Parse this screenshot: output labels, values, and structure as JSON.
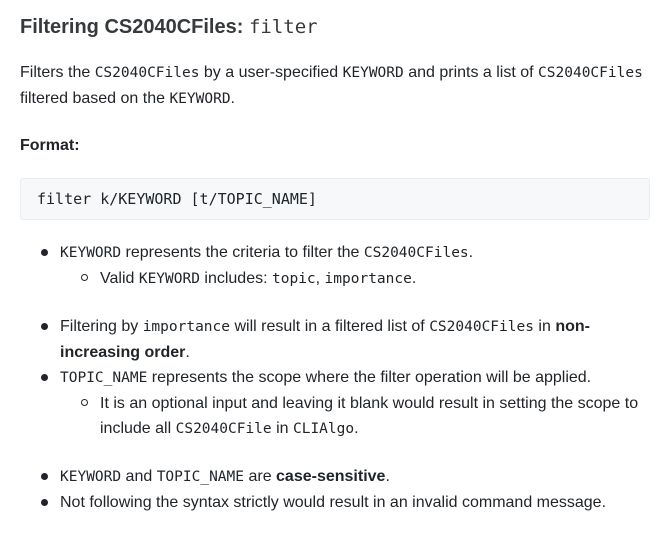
{
  "heading": {
    "prefix": "Filtering CS2040CFiles: ",
    "command": "filter"
  },
  "description": {
    "t1": "Filters the ",
    "c1": "CS2040CFiles",
    "t2": " by a user-specified ",
    "c2": "KEYWORD",
    "t3": " and prints a list of ",
    "c3": "CS2040CFiles",
    "t4": " filtered based on the ",
    "c4": "KEYWORD",
    "t5": "."
  },
  "format_label": "Format:",
  "format_code": "filter k/KEYWORD [t/TOPIC_NAME]",
  "bullets": {
    "b1": {
      "c1": "KEYWORD",
      "t1": " represents the criteria to filter the ",
      "c2": "CS2040CFiles",
      "t2": ".",
      "sub": {
        "t1": "Valid ",
        "c1": "KEYWORD",
        "t2": " includes: ",
        "c2": "topic",
        "t3": ", ",
        "c3": "importance",
        "t4": "."
      }
    },
    "b2": {
      "t1": "Filtering by ",
      "c1": "importance",
      "t2": " will result in a filtered list of ",
      "c2": "CS2040CFiles",
      "t3": " in ",
      "bold": "non-increasing order",
      "t4": "."
    },
    "b3": {
      "c1": "TOPIC_NAME",
      "t1": " represents the scope where the filter operation will be applied.",
      "sub": {
        "t1": "It is an optional input and leaving it blank would result in setting the scope to include all ",
        "c1": "CS2040CFile",
        "t2": " in ",
        "c2": "CLIAlgo",
        "t3": "."
      }
    },
    "b4": {
      "c1": "KEYWORD",
      "t1": " and ",
      "c2": "TOPIC_NAME",
      "t2": " are ",
      "bold": "case-sensitive",
      "t3": "."
    },
    "b5": {
      "t1": "Not following the syntax strictly would result in an invalid command message."
    }
  }
}
